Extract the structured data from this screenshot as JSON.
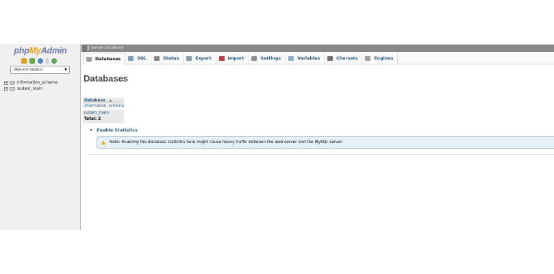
{
  "logo": {
    "part1": "php",
    "part2": "My",
    "part3": "Admin"
  },
  "nav": {
    "icons": [
      {
        "name": "home-icon",
        "color": "#e0a020"
      },
      {
        "name": "exit-icon",
        "color": "#6aa84f"
      },
      {
        "name": "help-icon",
        "color": "#4a86c8"
      },
      {
        "name": "docs-icon",
        "color": "#cccccc"
      },
      {
        "name": "reload-icon",
        "color": "#5aa85a"
      }
    ],
    "recent_tables": "(Recent tables)",
    "expander_symbol": "+",
    "dropdown_arrow": "▼",
    "databases": [
      {
        "label": "information_schema"
      },
      {
        "label": "sudam_main"
      }
    ]
  },
  "serverbar": {
    "title": "Server: localhost"
  },
  "tabs": [
    {
      "label": "Databases",
      "icon": "database-icon",
      "color": "#a0a0a0",
      "active": true
    },
    {
      "label": "SQL",
      "icon": "sql-icon",
      "color": "#7aa0c0"
    },
    {
      "label": "Status",
      "icon": "status-icon",
      "color": "#8a8a8a"
    },
    {
      "label": "Export",
      "icon": "export-icon",
      "color": "#8aa0b0"
    },
    {
      "label": "Import",
      "icon": "import-icon",
      "color": "#c04040"
    },
    {
      "label": "Settings",
      "icon": "settings-icon",
      "color": "#909090"
    },
    {
      "label": "Variables",
      "icon": "variables-icon",
      "color": "#8ab0d0"
    },
    {
      "label": "Charsets",
      "icon": "charsets-icon",
      "color": "#707070"
    },
    {
      "label": "Engines",
      "icon": "engines-icon",
      "color": "#a0a0a0"
    }
  ],
  "main": {
    "title": "Databases",
    "table": {
      "header": "Database",
      "sort_indicator": "▲",
      "rows": [
        "information_schema",
        "sudam_main"
      ],
      "total": "Total: 2"
    },
    "enable_statistics": "Enable Statistics",
    "notice": "Note: Enabling the database statistics here might cause heavy traffic between the web server and the MySQL server."
  },
  "colors": {
    "link": "#235a81",
    "logo_blue": "#6c78af",
    "logo_orange": "#f89c0e",
    "serverbar": "#888888",
    "notice_bg": "#e5f0f8"
  }
}
